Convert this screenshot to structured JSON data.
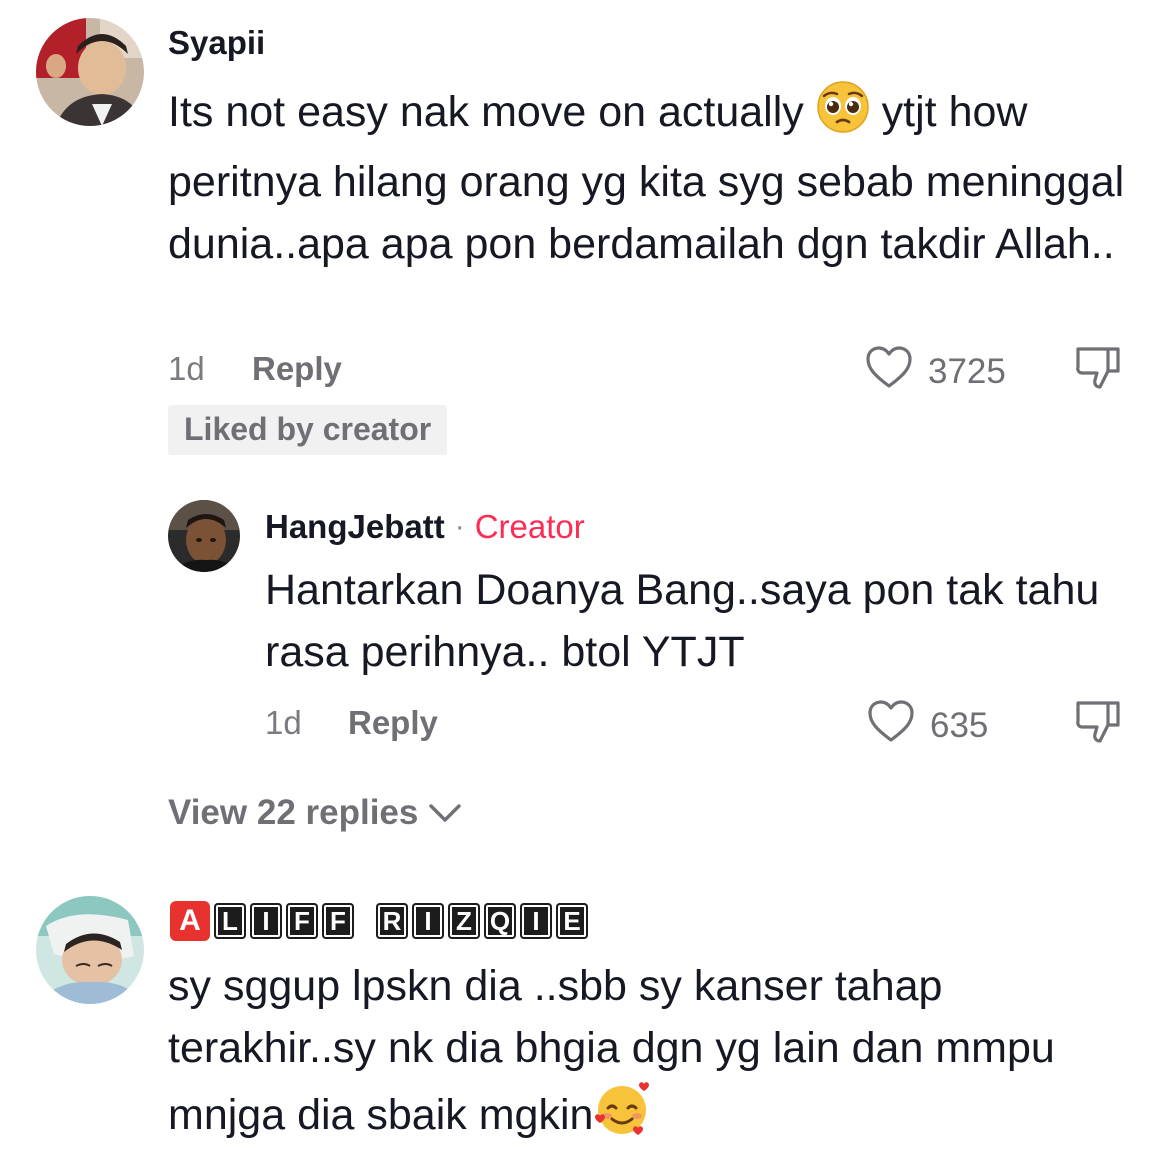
{
  "comments": [
    {
      "username": "Syapii",
      "text_part1": "Its not easy nak move on actually ",
      "text_emoji": "pleading-face",
      "text_part2": " ytjt how peritnya hilang orang yg kita syg sebab meninggal dunia..apa apa pon berdamailah dgn takdir Allah..",
      "time": "1d",
      "reply_label": "Reply",
      "likes": "3725",
      "badge": "Liked by creator"
    }
  ],
  "creator_reply": {
    "username": "HangJebatt",
    "separator": "·",
    "tag": "Creator",
    "text": "Hantarkan Doanya Bang..saya pon tak tahu rasa perihnya.. btol YTJT",
    "time": "1d",
    "reply_label": "Reply",
    "likes": "635"
  },
  "view_replies": "View 22 replies",
  "second_comment": {
    "username_letters": [
      "A",
      "L",
      "I",
      "F",
      "F",
      " ",
      "R",
      "I",
      "Z",
      "Q",
      "I",
      "E"
    ],
    "text": "sy sggup lpskn dia ..sbb sy kanser tahap terakhir..sy nk dia bhgia dgn yg lain dan mmpu mnjga dia sbaik mgkin",
    "text_emoji": "smiling-face-with-hearts"
  },
  "colors": {
    "text": "#161823",
    "muted": "#6f6f75",
    "creator": "#fe2c55",
    "badge_bg": "#f1f1f2"
  }
}
